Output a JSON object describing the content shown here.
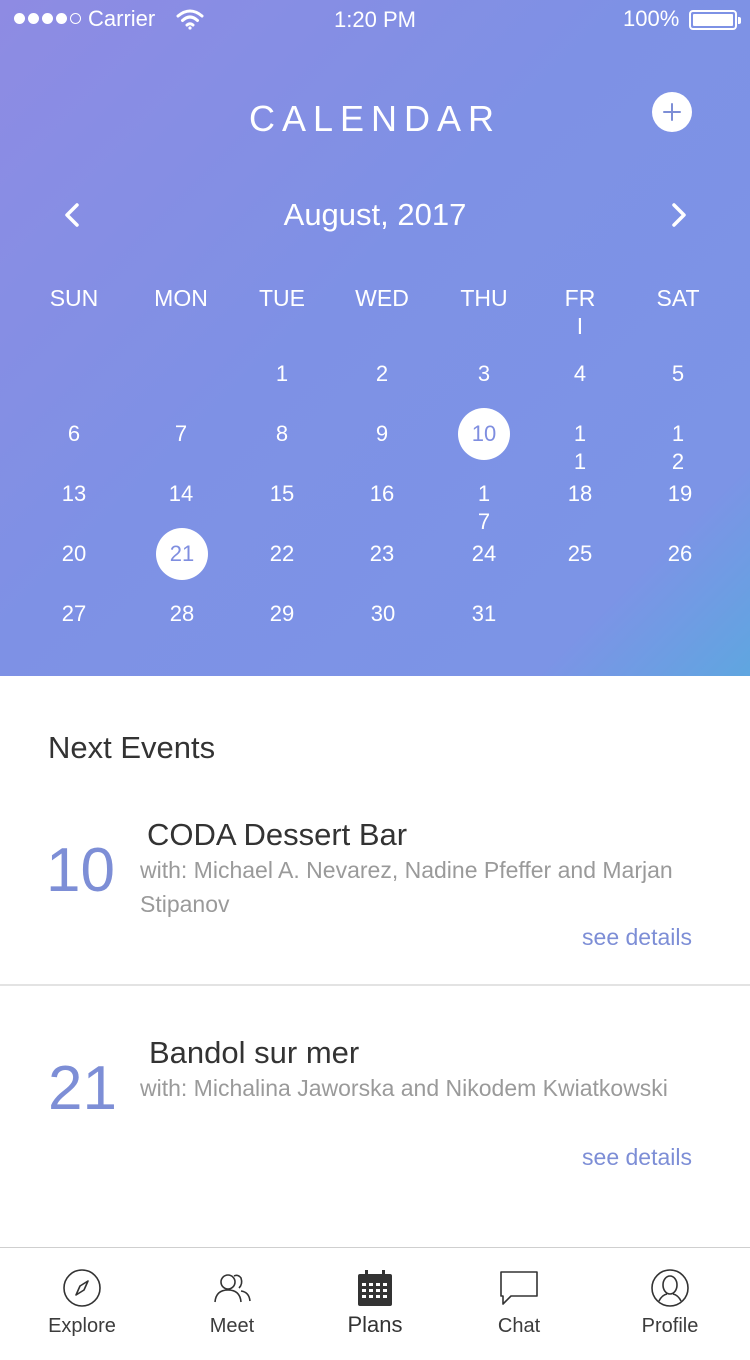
{
  "status_bar": {
    "carrier": "Carrier",
    "time": "1:20 PM",
    "battery": "100%"
  },
  "header": {
    "title": "CALENDAR",
    "add_label": "+"
  },
  "calendar": {
    "month_label": "August, 2017",
    "weekdays": [
      "SUN",
      "MON",
      "TUE",
      "WED",
      "THU",
      "FRI",
      "SAT"
    ],
    "days": [
      "1",
      "2",
      "3",
      "4",
      "5",
      "6",
      "7",
      "8",
      "9",
      "10",
      "11",
      "12",
      "13",
      "14",
      "15",
      "16",
      "17",
      "18",
      "19",
      "20",
      "21",
      "22",
      "23",
      "24",
      "25",
      "26",
      "27",
      "28",
      "29",
      "30",
      "31"
    ],
    "selected_days": [
      "10",
      "21"
    ]
  },
  "events": {
    "heading": "Next Events",
    "items": [
      {
        "day": "10",
        "title": "CODA Dessert Bar",
        "with": "with: Michael A. Nevarez, Nadine Pfeffer and Marjan Stipanov",
        "link": "see details"
      },
      {
        "day": "21",
        "title": "Bandol sur mer",
        "with": "with: Michalina Jaworska and Nikodem Kwiatkowski",
        "link": "see details"
      }
    ]
  },
  "tabbar": {
    "items": [
      {
        "label": "Explore",
        "icon": "compass-icon"
      },
      {
        "label": "Meet",
        "icon": "people-icon"
      },
      {
        "label": "Plans",
        "icon": "calendar-icon",
        "active": true
      },
      {
        "label": "Chat",
        "icon": "chat-bubble-icon"
      },
      {
        "label": "Profile",
        "icon": "profile-icon"
      }
    ]
  },
  "colors": {
    "accent": "#7d8ed6",
    "hero_start": "#8e8be3",
    "hero_end": "#5fa6e0"
  }
}
